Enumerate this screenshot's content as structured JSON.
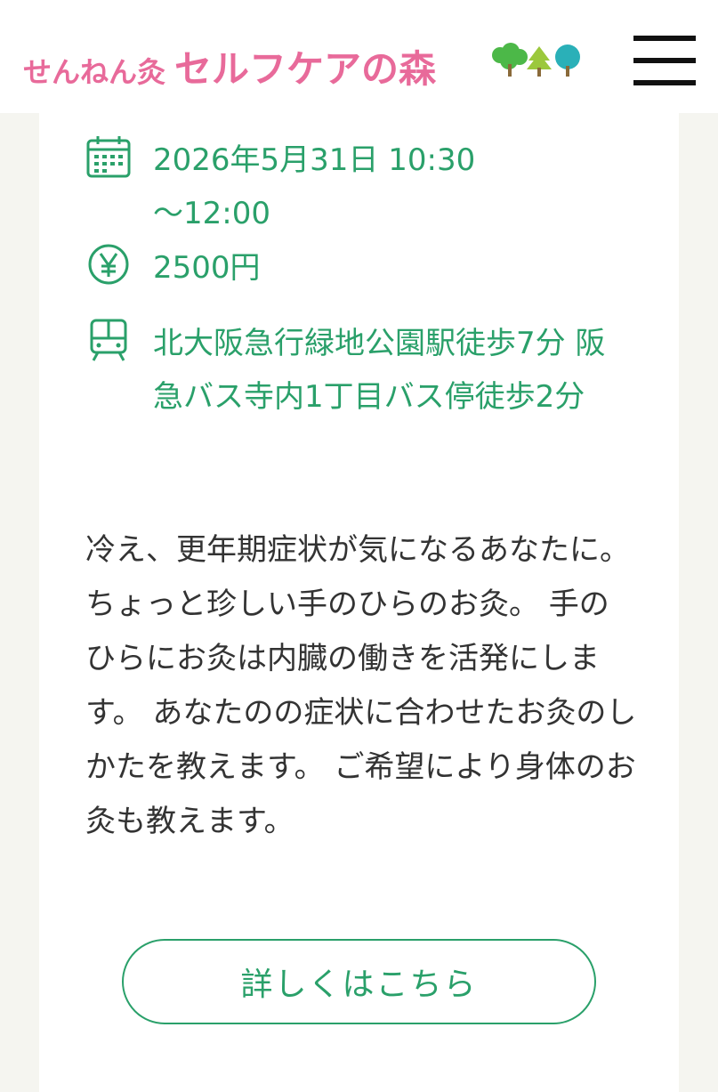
{
  "header": {
    "logo_small": "せんねん灸",
    "logo_large": "セルフケアの森",
    "trees_icon": "trees-icon",
    "menu_icon": "hamburger-menu-icon"
  },
  "event": {
    "date_line1": "2026年5月31日 10:30",
    "date_line2": "～12:00",
    "price": "2500円",
    "access": "北大阪急行緑地公園駅徒歩7分 阪急バス寺内1丁目バス停徒歩2分",
    "calendar_icon": "calendar-icon",
    "price_icon": "yen-icon",
    "transit_icon": "train-icon"
  },
  "description": "冷え、更年期症状が気になるあなたに。 ちょっと珍しい手のひらのお灸。 手のひらにお灸は内臓の働きを活発にします。 あなたのの症状に合わせたお灸のしかたを教えます。 ご希望により身体のお灸も教えます。",
  "button": {
    "label": "詳しくはこちら"
  },
  "colors": {
    "brand_pink": "#e86a9a",
    "accent_green": "#2aa06a",
    "text": "#333333",
    "background": "#f5f5f0"
  }
}
